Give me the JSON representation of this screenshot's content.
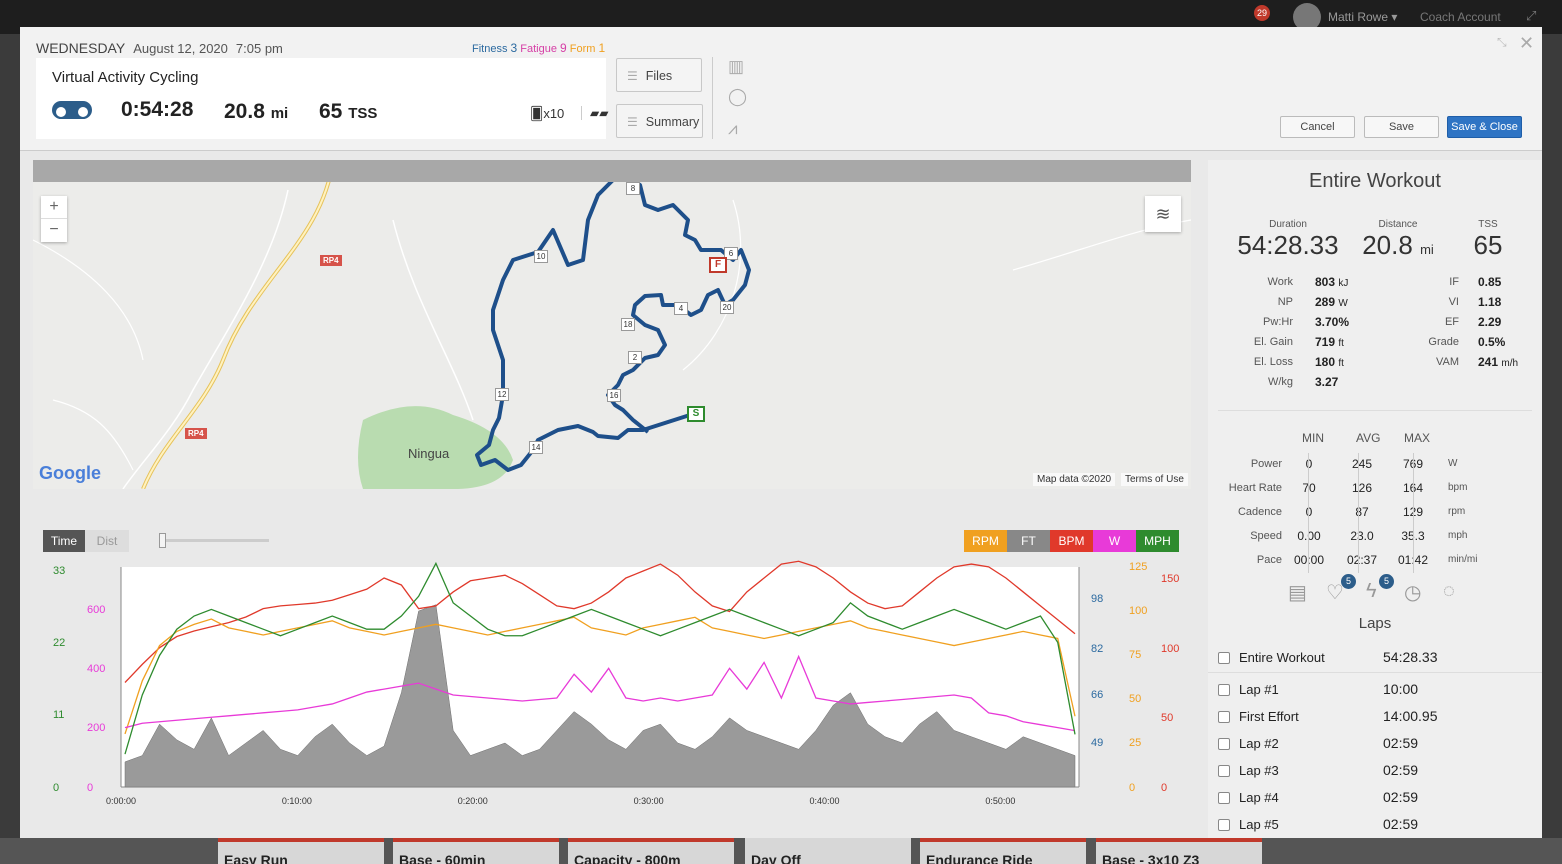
{
  "topbar": {
    "notif_count": "29",
    "user_name": "Matti Rowe ▾",
    "coach_label": "Coach Account"
  },
  "calendar_bg": [
    "Easy Run",
    "Base - 60min",
    "Capacity - 800m",
    "Day Off",
    "Endurance Ride",
    "Base - 3x10 Z3"
  ],
  "header": {
    "day": "Wednesday",
    "date": "August 12, 2020",
    "time": "7:05 pm",
    "fitness_label": "Fitness",
    "fitness_value": "3",
    "fatigue_label": "Fatigue",
    "fatigue_value": "9",
    "form_label": "Form",
    "form_value": "1",
    "title": "Virtual Activity Cycling",
    "duration": "0:54:28",
    "distance": "20.8",
    "distance_unit": "mi",
    "tss": "65",
    "tss_unit": "TSS",
    "rpe": "x10",
    "files_label": "Files",
    "summary_label": "Summary",
    "cancel_label": "Cancel",
    "save_label": "Save",
    "save_close_label": "Save & Close"
  },
  "map": {
    "place_label": "Ningua",
    "road_labels": [
      "RP4",
      "RP4"
    ],
    "markers": [
      "8",
      "6",
      "10",
      "4",
      "20",
      "18",
      "2",
      "16",
      "12",
      "14"
    ],
    "start_label": "S",
    "finish_label": "F",
    "google_label": "Google",
    "map_data_label": "Map data ©2020",
    "terms_label": "Terms of Use",
    "zoom_in": "+",
    "zoom_out": "−"
  },
  "chart_controls": {
    "time_label": "Time",
    "dist_label": "Dist",
    "legend": [
      {
        "label": "RPM",
        "color": "#f0a020"
      },
      {
        "label": "FT",
        "color": "#888888"
      },
      {
        "label": "BPM",
        "color": "#e0392b"
      },
      {
        "label": "W",
        "color": "#e83ad8"
      },
      {
        "label": "MPH",
        "color": "#2e8b2e"
      }
    ]
  },
  "chart_data": {
    "type": "line",
    "x_ticks": [
      "0:00:00",
      "0:10:00",
      "0:20:00",
      "0:30:00",
      "0:40:00",
      "0:50:00"
    ],
    "axes": {
      "speed_mph": {
        "ticks": [
          "0",
          "11",
          "22",
          "33"
        ],
        "color": "#2e8b2e"
      },
      "power_w": {
        "ticks": [
          "0",
          "200",
          "400",
          "600"
        ],
        "color": "#e83ad8"
      },
      "elevation_ft": {
        "ticks": [
          "49",
          "66",
          "82",
          "98"
        ],
        "color": "#2c6aa0"
      },
      "cadence_rpm": {
        "ticks": [
          "0",
          "25",
          "50",
          "75",
          "100",
          "125"
        ],
        "color": "#f0a020"
      },
      "heart_rate_bpm": {
        "ticks": [
          "0",
          "50",
          "100",
          "150"
        ],
        "color": "#e0392b"
      }
    },
    "series": [
      {
        "name": "BPM",
        "values": [
          75,
          88,
          100,
          108,
          112,
          115,
          118,
          122,
          128,
          130,
          131,
          132,
          134,
          138,
          142,
          150,
          145,
          128,
          130,
          140,
          148,
          150,
          152,
          146,
          138,
          130,
          128,
          132,
          140,
          150,
          155,
          160,
          152,
          140,
          130,
          126,
          140,
          150,
          160,
          162,
          158,
          150,
          140,
          132,
          128,
          130,
          140,
          150,
          158,
          160,
          158,
          150,
          140,
          130,
          120,
          110
        ]
      },
      {
        "name": "RPM",
        "values": [
          30,
          60,
          80,
          88,
          92,
          95,
          90,
          88,
          86,
          88,
          90,
          92,
          94,
          90,
          88,
          86,
          88,
          90,
          92,
          90,
          88,
          86,
          88,
          90,
          92,
          94,
          96,
          90,
          88,
          86,
          90,
          92,
          94,
          96,
          90,
          88,
          86,
          84,
          86,
          88,
          90,
          92,
          94,
          90,
          88,
          86,
          84,
          82,
          80,
          82,
          84,
          86,
          88,
          86,
          84,
          40
        ]
      },
      {
        "name": "W",
        "values": [
          200,
          215,
          220,
          225,
          230,
          235,
          240,
          245,
          250,
          255,
          260,
          270,
          280,
          300,
          320,
          330,
          340,
          350,
          330,
          310,
          305,
          300,
          295,
          290,
          295,
          300,
          380,
          320,
          400,
          300,
          290,
          300,
          290,
          300,
          310,
          400,
          330,
          420,
          300,
          440,
          300,
          290,
          280,
          285,
          290,
          295,
          300,
          305,
          310,
          300,
          250,
          240,
          220,
          210,
          200,
          190
        ]
      },
      {
        "name": "MPH",
        "values": [
          5,
          14,
          20,
          24,
          26,
          27,
          26,
          25,
          24,
          23,
          24,
          25,
          26,
          25,
          24,
          24,
          26,
          29,
          34,
          28,
          26,
          24,
          23,
          23,
          24,
          25,
          26,
          27,
          26,
          25,
          24,
          23,
          24,
          25,
          26,
          27,
          26,
          25,
          24,
          23,
          24,
          25,
          28,
          26,
          25,
          24,
          25,
          26,
          27,
          26,
          25,
          24,
          25,
          26,
          22,
          8
        ]
      },
      {
        "name": "FT",
        "values": [
          48,
          50,
          60,
          55,
          52,
          62,
          50,
          54,
          58,
          52,
          50,
          56,
          60,
          54,
          50,
          53,
          70,
          96,
          98,
          58,
          50,
          52,
          54,
          50,
          52,
          58,
          64,
          60,
          55,
          52,
          58,
          60,
          54,
          52,
          56,
          62,
          58,
          56,
          54,
          52,
          58,
          66,
          70,
          60,
          56,
          54,
          60,
          64,
          58,
          56,
          54,
          52,
          56,
          54,
          52,
          50
        ]
      }
    ]
  },
  "summary": {
    "title": "Entire Workout",
    "duration_label": "Duration",
    "duration_value": "54:28.33",
    "distance_label": "Distance",
    "distance_value": "20.8",
    "distance_unit": "mi",
    "tss_label": "TSS",
    "tss_value": "65",
    "left_metrics": [
      {
        "label": "Work",
        "value": "803",
        "unit": "kJ"
      },
      {
        "label": "NP",
        "value": "289",
        "unit": "W"
      },
      {
        "label": "Pw:Hr",
        "value": "3.70%",
        "unit": ""
      },
      {
        "label": "El. Gain",
        "value": "719",
        "unit": "ft"
      },
      {
        "label": "El. Loss",
        "value": "180",
        "unit": "ft"
      },
      {
        "label": "W/kg",
        "value": "3.27",
        "unit": ""
      }
    ],
    "right_metrics": [
      {
        "label": "IF",
        "value": "0.85",
        "unit": ""
      },
      {
        "label": "VI",
        "value": "1.18",
        "unit": ""
      },
      {
        "label": "EF",
        "value": "2.29",
        "unit": ""
      },
      {
        "label": "Grade",
        "value": "0.5%",
        "unit": ""
      },
      {
        "label": "VAM",
        "value": "241",
        "unit": "m/h"
      }
    ],
    "stats_headers": [
      "MIN",
      "AVG",
      "MAX"
    ],
    "stats": [
      {
        "label": "Power",
        "min": "0",
        "avg": "245",
        "max": "769",
        "unit": "W"
      },
      {
        "label": "Heart Rate",
        "min": "70",
        "avg": "126",
        "max": "164",
        "unit": "bpm"
      },
      {
        "label": "Cadence",
        "min": "0",
        "avg": "87",
        "max": "129",
        "unit": "rpm"
      },
      {
        "label": "Speed",
        "min": "0.00",
        "avg": "23.0",
        "max": "35.3",
        "unit": "mph"
      },
      {
        "label": "Pace",
        "min": "00:00",
        "avg": "02:37",
        "max": "01:42",
        "unit": "min/mi"
      }
    ],
    "heart_badge": "5",
    "bolt_badge": "5",
    "laps_title": "Laps",
    "laps": [
      {
        "name": "Entire Workout",
        "value": "54:28.33"
      },
      {
        "name": "Lap #1",
        "value": "10:00"
      },
      {
        "name": "First Effort",
        "value": "14:00.95"
      },
      {
        "name": "Lap #2",
        "value": "02:59"
      },
      {
        "name": "Lap #3",
        "value": "02:59"
      },
      {
        "name": "Lap #4",
        "value": "02:59"
      },
      {
        "name": "Lap #5",
        "value": "02:59"
      }
    ]
  }
}
